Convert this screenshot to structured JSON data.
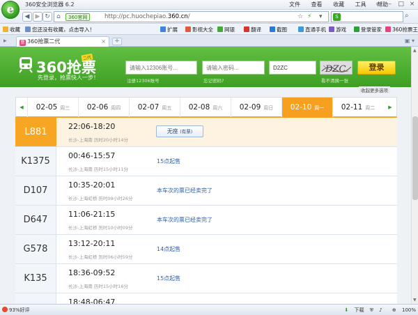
{
  "window": {
    "title": "360安全浏览器 6.2",
    "logo": "e",
    "menus": [
      "文件",
      "查看",
      "收藏",
      "工具",
      "帮助"
    ],
    "controls": [
      "▭",
      "–",
      "□",
      "×"
    ]
  },
  "navbar": {
    "back": "◀",
    "forward": "▶",
    "refresh": "↻",
    "home": "⌂",
    "badge": "360官网",
    "url_prefix": "http://pc.huochepiao.",
    "url_domain": "360.cn",
    "url_suffix": "/",
    "search_value": "",
    "search_logo": "S"
  },
  "favbar": {
    "left": [
      {
        "label": "收藏",
        "color": "#f0b32b"
      },
      {
        "label": "您还没有收藏，点击导入！",
        "color": ""
      }
    ],
    "right": [
      {
        "label": "扩展",
        "color": "#3d85d8"
      },
      {
        "label": "影视大全",
        "color": "#e05a3c"
      },
      {
        "label": "网银",
        "color": "#49a83a"
      },
      {
        "label": "翻译",
        "color": "#d9342b"
      },
      {
        "label": "截图",
        "color": "#2b7ad9"
      },
      {
        "label": "直通手机",
        "color": "#3b9ad9"
      },
      {
        "label": "游戏",
        "color": "#7c5ac6"
      },
      {
        "label": "登录管家",
        "color": "#2f9f3a"
      },
      {
        "label": "360抢票王",
        "color": "#e4437d"
      }
    ]
  },
  "tabbar": {
    "tab_label": "360抢票二代",
    "tab_icon": "票",
    "close": "×",
    "new_tab": "+"
  },
  "header": {
    "brand": "360抢票",
    "tag": "二代",
    "slogan": "先登录，抢票快人一步！",
    "username_placeholder": "请输入12306账号...",
    "password_placeholder": "请输入密码...",
    "captcha_value": "D2ZC",
    "captcha_image_text": "DZC",
    "register_hint": "注册12306账号",
    "forgot_hint": "忘记密码?",
    "refresh_hint": "看不清换一张",
    "login_button": "登录",
    "more_dates": "收起更多选项"
  },
  "dates": [
    {
      "date": "02-05",
      "weekday": "周三",
      "active": false
    },
    {
      "date": "02-06",
      "weekday": "周四",
      "active": false
    },
    {
      "date": "02-07",
      "weekday": "周五",
      "active": false
    },
    {
      "date": "02-08",
      "weekday": "周六",
      "active": false
    },
    {
      "date": "02-09",
      "weekday": "周日",
      "active": false
    },
    {
      "date": "02-10",
      "weekday": "周一",
      "active": true
    },
    {
      "date": "02-11",
      "weekday": "周二",
      "active": false
    }
  ],
  "date_prev": "◀",
  "date_next": "▶",
  "trains": [
    {
      "number": "L881",
      "time": "22:06-18:20",
      "route": "长沙-上海南 历时20小时14分",
      "status": "",
      "seat_button": "无座",
      "seat_sub": "(有票)",
      "selected": true
    },
    {
      "number": "K1375",
      "time": "00:46-15:57",
      "route": "长沙-上海南 历时15小时11分",
      "status": "15点起售",
      "selected": false
    },
    {
      "number": "D107",
      "time": "10:35-20:01",
      "route": "长沙-上海虹桥 历时09小时26分",
      "status": "本车次的票已经卖完了",
      "selected": false
    },
    {
      "number": "D647",
      "time": "11:06-21:15",
      "route": "长沙-上海虹桥 历时10小时09分",
      "status": "本车次的票已经卖完了",
      "selected": false
    },
    {
      "number": "G578",
      "time": "13:12-20:11",
      "route": "长沙-上海虹桥 历时06小时59分",
      "status": "14点起售",
      "selected": false
    },
    {
      "number": "K135",
      "time": "18:36-09:52",
      "route": "长沙-上海南 历时15小时16分",
      "status": "15点起售",
      "selected": false
    },
    {
      "number": "",
      "time": "18:48-06:47",
      "route": "",
      "status": "",
      "selected": false
    }
  ],
  "statusbar": {
    "rating": "93%好评",
    "download": "下载",
    "zoom": "100%"
  }
}
